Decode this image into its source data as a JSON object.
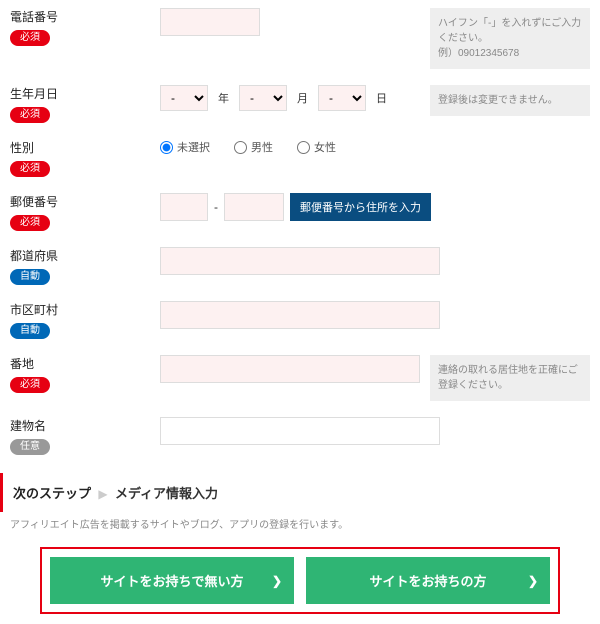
{
  "badges": {
    "required": "必須",
    "auto": "自動",
    "optional": "任意"
  },
  "phone": {
    "label": "電話番号",
    "hint": "ハイフン「-」を入れずにご入力ください。\n例）09012345678"
  },
  "birth": {
    "label": "生年月日",
    "year": "-",
    "month": "-",
    "day": "-",
    "yu": "年",
    "mu": "月",
    "du": "日",
    "hint": "登録後は変更できません。"
  },
  "gender": {
    "label": "性別",
    "opts": [
      "未選択",
      "男性",
      "女性"
    ]
  },
  "postal": {
    "label": "郵便番号",
    "btn": "郵便番号から住所を入力"
  },
  "pref": {
    "label": "都道府県"
  },
  "city": {
    "label": "市区町村"
  },
  "street": {
    "label": "番地",
    "hint": "連絡の取れる居住地を正確にご登録ください。"
  },
  "building": {
    "label": "建物名"
  },
  "next": {
    "step": "次のステップ",
    "arrow": "▶",
    "title": "メディア情報入力",
    "desc": "アフィリエイト広告を掲載するサイトやブログ、アプリの登録を行います。"
  },
  "cta": {
    "no_site": "サイトをお持ちで無い方",
    "has_site": "サイトをお持ちの方",
    "chev": "❯"
  }
}
